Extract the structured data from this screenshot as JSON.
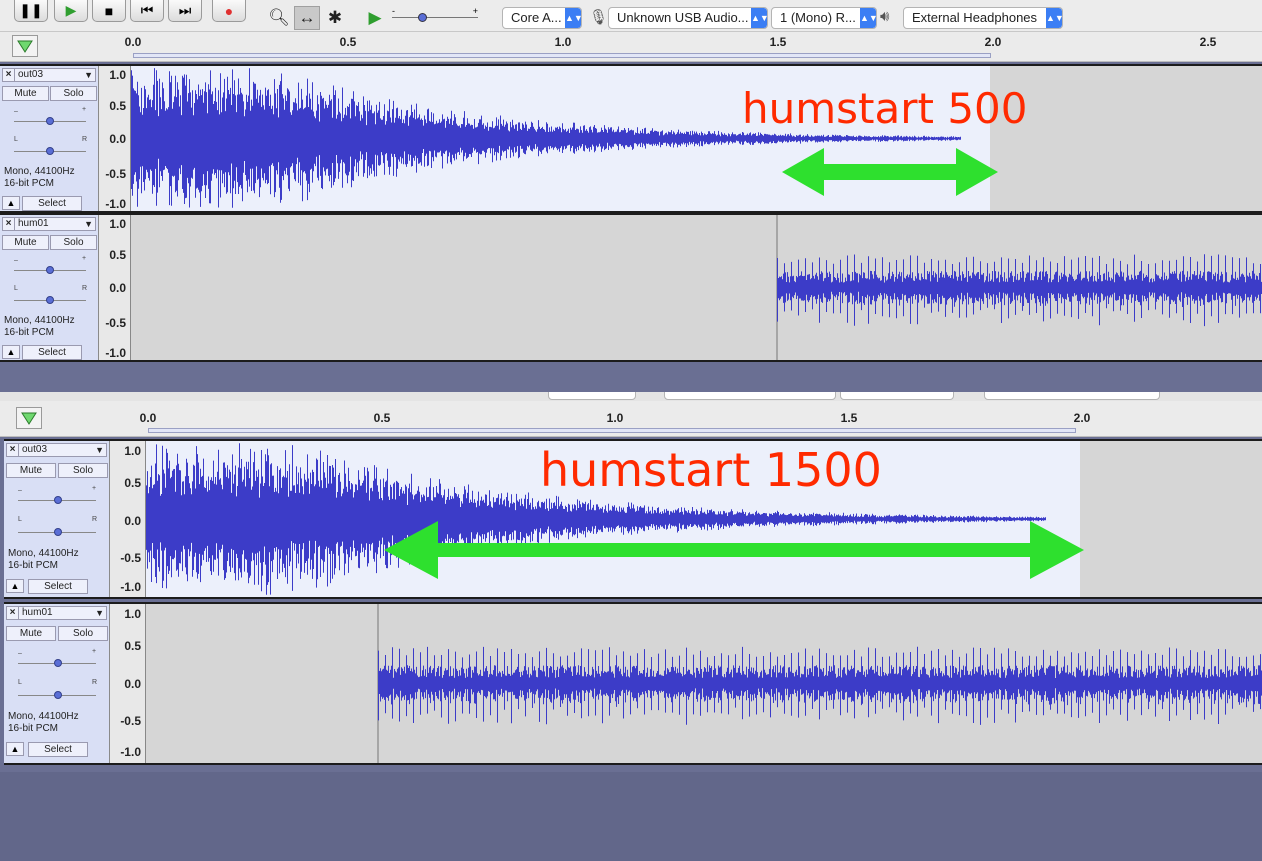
{
  "toolbar": {
    "zoom_tool_icon": "magnifier-icon",
    "timeshift_tool_icon": "double-arrow-icon",
    "multi_tool_icon": "asterisk-icon",
    "host_combo": "Core A...",
    "mic_icon": "microphone-icon",
    "input_device_combo": "Unknown USB Audio...",
    "channels_combo": "1 (Mono) R...",
    "speaker_icon": "speaker-icon",
    "output_device_combo": "External Headphones"
  },
  "panels": [
    {
      "ruler_ticks": [
        "0.0",
        "0.5",
        "1.0",
        "1.5",
        "2.0",
        "2.5"
      ],
      "annotation": "humstart 500",
      "tracks": [
        {
          "name": "out03",
          "mute": "Mute",
          "solo": "Solo",
          "format_line1": "Mono, 44100Hz",
          "format_line2": "16-bit PCM",
          "select": "Select",
          "pan_left": "L",
          "pan_right": "R",
          "gain_minus": "–",
          "gain_plus": "+",
          "scale": [
            "1.0",
            "0.5",
            "0.0",
            "-0.5",
            "-1.0"
          ]
        },
        {
          "name": "hum01",
          "mute": "Mute",
          "solo": "Solo",
          "format_line1": "Mono, 44100Hz",
          "format_line2": "16-bit PCM",
          "select": "Select",
          "pan_left": "L",
          "pan_right": "R",
          "gain_minus": "–",
          "gain_plus": "+",
          "scale": [
            "1.0",
            "0.5",
            "0.0",
            "-0.5",
            "-1.0"
          ]
        }
      ]
    },
    {
      "ruler_ticks": [
        "0.0",
        "0.5",
        "1.0",
        "1.5",
        "2.0"
      ],
      "annotation": "humstart 1500",
      "tracks": [
        {
          "name": "out03",
          "mute": "Mute",
          "solo": "Solo",
          "format_line1": "Mono, 44100Hz",
          "format_line2": "16-bit PCM",
          "select": "Select",
          "pan_left": "L",
          "pan_right": "R",
          "gain_minus": "–",
          "gain_plus": "+",
          "scale": [
            "1.0",
            "0.5",
            "0.0",
            "-0.5",
            "-1.0"
          ]
        },
        {
          "name": "hum01",
          "mute": "Mute",
          "solo": "Solo",
          "format_line1": "Mono, 44100Hz",
          "format_line2": "16-bit PCM",
          "select": "Select",
          "pan_left": "L",
          "pan_right": "R",
          "gain_minus": "–",
          "gain_plus": "+",
          "scale": [
            "1.0",
            "0.5",
            "0.0",
            "-0.5",
            "-1.0"
          ]
        }
      ]
    }
  ],
  "colors": {
    "waveform": "#3c3cc8",
    "selected_bg": "#ecf0fb",
    "annotation_text": "#ff2a00",
    "arrow": "#2ee02e"
  }
}
